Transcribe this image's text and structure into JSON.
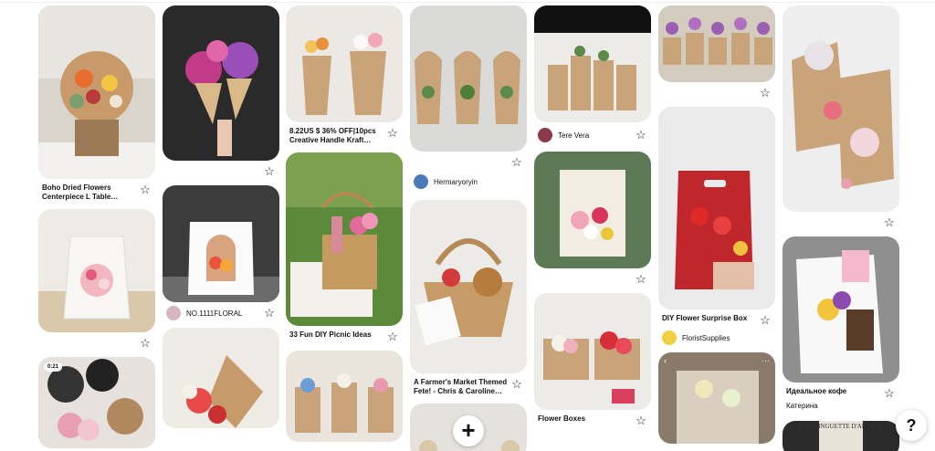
{
  "pins": {
    "c1": [
      {
        "title": "Boho Dried Flowers Centerpiece L Table…"
      },
      {},
      {
        "badge": "0:21"
      }
    ],
    "c2": [
      {},
      {
        "user": "NO.1111FLORAL"
      },
      {}
    ],
    "c3": [
      {
        "title": "8.22US $ 36% OFF|10pcs Creative Handle Kraft Pape…"
      },
      {
        "title": "33 Fun DIY Picnic Ideas"
      },
      {}
    ],
    "c4": [
      {
        "user": "Hermaryoryin"
      },
      {
        "title": "A Farmer's Market Themed Fete! - Chris & Caroline…"
      },
      {}
    ],
    "c5": [
      {
        "user": "Tere Vera"
      },
      {},
      {
        "title": "Flower Boxes"
      }
    ],
    "c6": [
      {},
      {
        "title": "DIY Flower Surprise Box",
        "user": "FloristSupplies"
      },
      {}
    ],
    "c7": [
      {},
      {
        "title": "Идеальное кофе",
        "user": "Катерина"
      },
      {
        "brand": "LA GUINGUETTE D'ANGELE"
      }
    ]
  },
  "controls": {
    "plus_symbol": "+",
    "help_symbol": "?",
    "star_symbol": "☆",
    "more_symbol": "···",
    "back_symbol": "‹"
  },
  "colors": {
    "background": "#ffffff",
    "text": "#111111"
  }
}
